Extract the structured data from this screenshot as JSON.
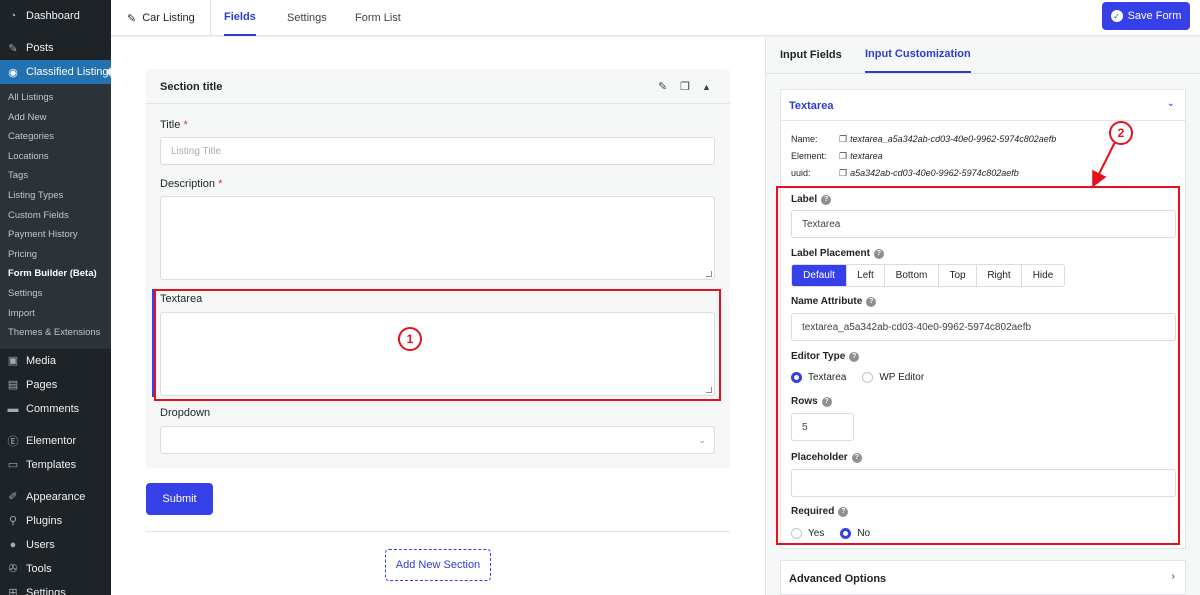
{
  "sidebar": {
    "top": [
      {
        "label": "Dashboard",
        "icon": "dashboard-icon"
      },
      {
        "label": "Posts",
        "icon": "pin-icon"
      },
      {
        "label": "Classified Listing",
        "icon": "map-pin-icon",
        "active": true
      }
    ],
    "sub": [
      {
        "label": "All Listings"
      },
      {
        "label": "Add New"
      },
      {
        "label": "Categories"
      },
      {
        "label": "Locations"
      },
      {
        "label": "Tags"
      },
      {
        "label": "Listing Types"
      },
      {
        "label": "Custom Fields"
      },
      {
        "label": "Payment History"
      },
      {
        "label": "Pricing"
      },
      {
        "label": "Form Builder (Beta)",
        "current": true
      },
      {
        "label": "Settings"
      },
      {
        "label": "Import"
      },
      {
        "label": "Themes & Extensions"
      }
    ],
    "bottom": [
      {
        "label": "Media",
        "icon": "media-icon"
      },
      {
        "label": "Pages",
        "icon": "pages-icon"
      },
      {
        "label": "Comments",
        "icon": "comments-icon"
      },
      {
        "label": "Elementor",
        "icon": "elementor-icon"
      },
      {
        "label": "Templates",
        "icon": "folder-icon"
      },
      {
        "label": "Appearance",
        "icon": "brush-icon"
      },
      {
        "label": "Plugins",
        "icon": "plug-icon"
      },
      {
        "label": "Users",
        "icon": "users-icon"
      },
      {
        "label": "Tools",
        "icon": "wrench-icon"
      },
      {
        "label": "Settings",
        "icon": "settings-icon"
      }
    ]
  },
  "topbar": {
    "breadcrumb": "Car Listing",
    "tabs": [
      "Fields",
      "Settings",
      "Form List"
    ],
    "save_label": "Save Form"
  },
  "section": {
    "title": "Section title",
    "fields": {
      "title_label": "Title",
      "title_placeholder": "Listing Title",
      "description_label": "Description",
      "textarea_label": "Textarea",
      "dropdown_label": "Dropdown"
    },
    "required_mark": "*"
  },
  "main": {
    "submit_label": "Submit",
    "add_section_label": "Add New Section"
  },
  "annotations": {
    "badge_1": "1",
    "badge_2": "2"
  },
  "right_panel": {
    "tabs": [
      "Input Fields",
      "Input Customization"
    ],
    "card_title": "Textarea",
    "meta": {
      "name_key": "Name:",
      "name_value": "textarea_a5a342ab-cd03-40e0-9962-5974c802aefb",
      "element_key": "Element:",
      "element_value": "textarea",
      "uuid_key": "uuid:",
      "uuid_value": "a5a342ab-cd03-40e0-9962-5974c802aefb"
    },
    "label_title": "Label",
    "label_value": "Textarea",
    "placement_title": "Label Placement",
    "placement_options": [
      "Default",
      "Left",
      "Bottom",
      "Top",
      "Right",
      "Hide"
    ],
    "placement_selected": "Default",
    "name_attr_title": "Name Attribute",
    "name_attr_value": "textarea_a5a342ab-cd03-40e0-9962-5974c802aefb",
    "editor_type_title": "Editor Type",
    "editor_options": [
      "Textarea",
      "WP Editor"
    ],
    "editor_selected": "Textarea",
    "rows_title": "Rows",
    "rows_value": "5",
    "placeholder_title": "Placeholder",
    "placeholder_value": "",
    "required_title": "Required",
    "required_options": [
      "Yes",
      "No"
    ],
    "required_selected": "No",
    "advanced_title": "Advanced Options"
  },
  "colors": {
    "accent": "#3640e8",
    "annotation_red": "#e5111c",
    "sidebar_bg": "#1d2327",
    "sidebar_active": "#2271b1"
  }
}
